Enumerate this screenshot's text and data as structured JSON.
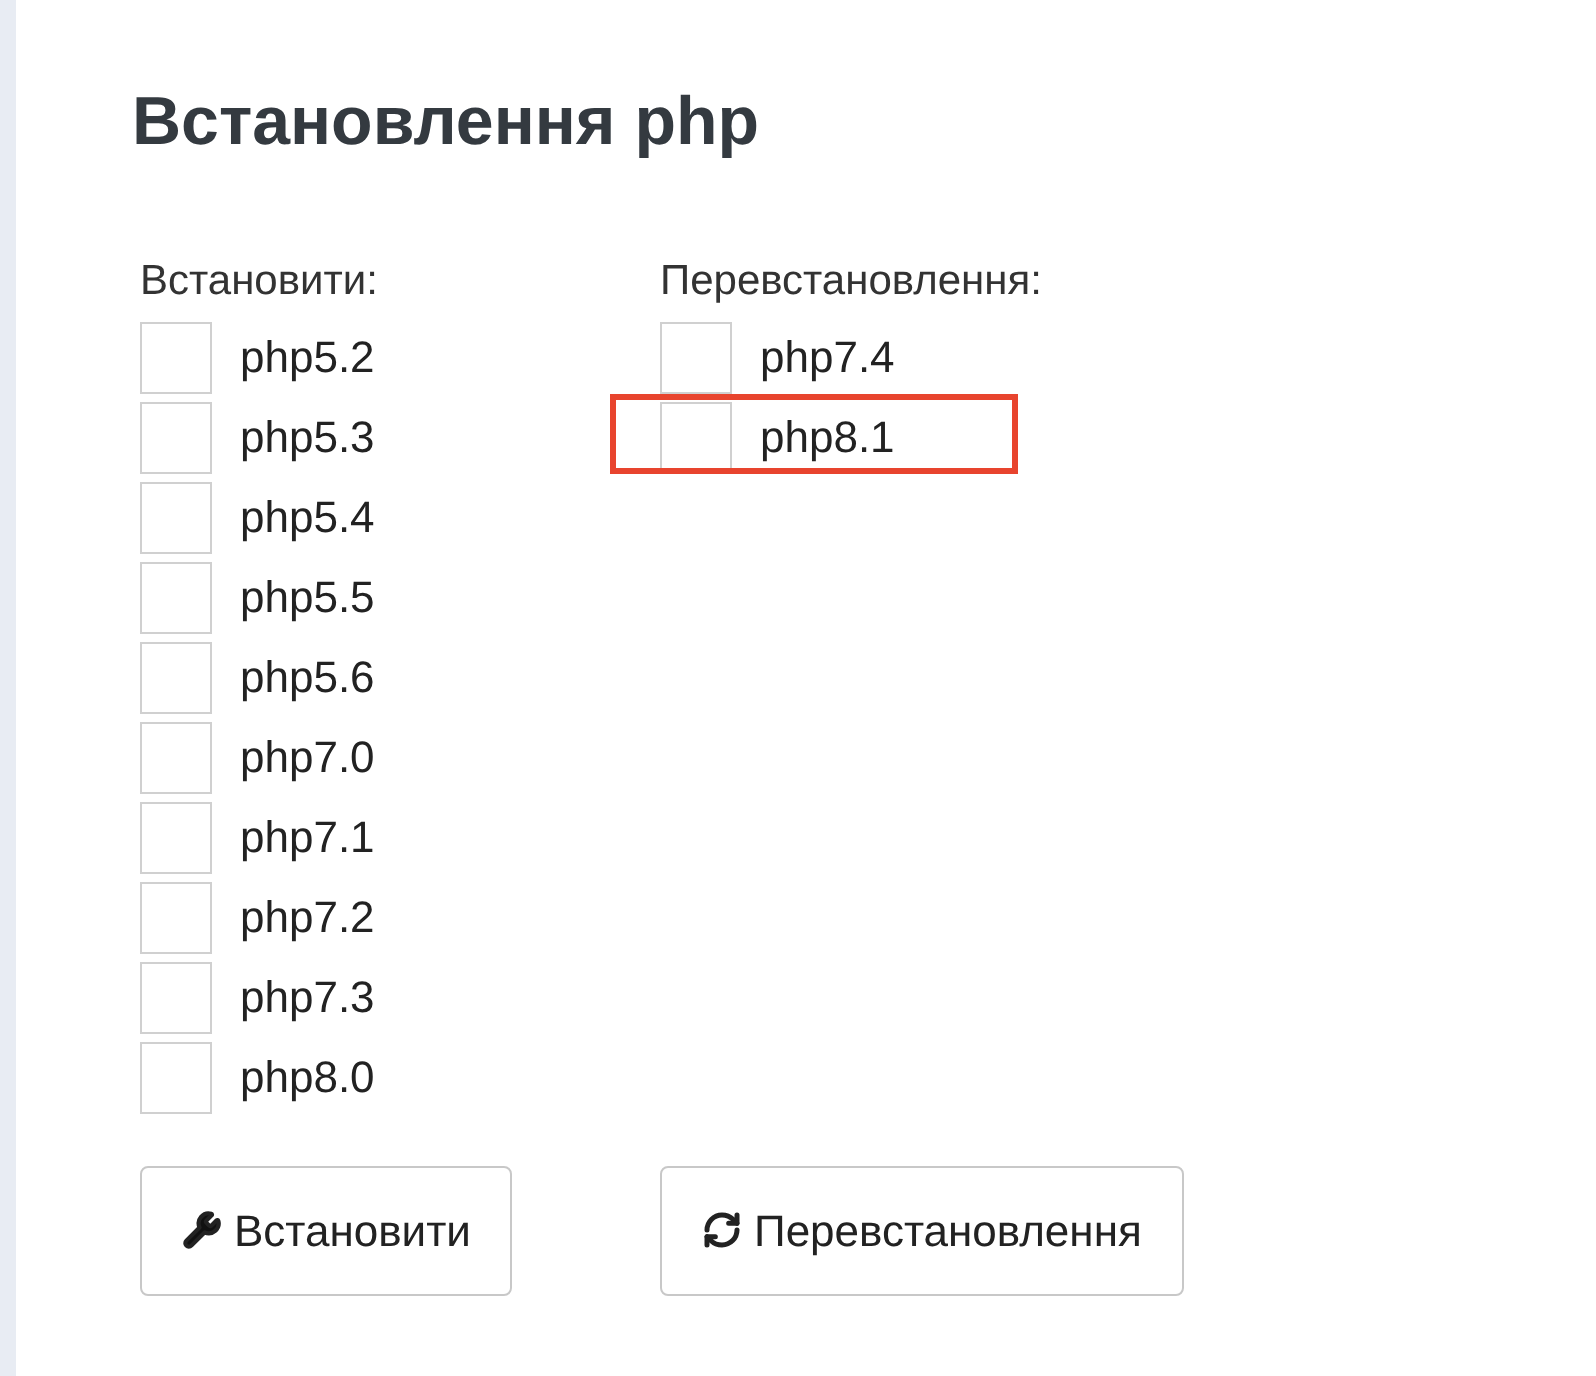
{
  "title": "Встановлення php",
  "install": {
    "label": "Встановити:",
    "items": [
      {
        "label": "php5.2",
        "checked": false
      },
      {
        "label": "php5.3",
        "checked": false
      },
      {
        "label": "php5.4",
        "checked": false
      },
      {
        "label": "php5.5",
        "checked": false
      },
      {
        "label": "php5.6",
        "checked": false
      },
      {
        "label": "php7.0",
        "checked": false
      },
      {
        "label": "php7.1",
        "checked": false
      },
      {
        "label": "php7.2",
        "checked": false
      },
      {
        "label": "php7.3",
        "checked": false
      },
      {
        "label": "php8.0",
        "checked": false
      }
    ]
  },
  "reinstall": {
    "label": "Перевстановлення:",
    "items": [
      {
        "label": "php7.4",
        "checked": false,
        "highlighted": false
      },
      {
        "label": "php8.1",
        "checked": false,
        "highlighted": true
      }
    ]
  },
  "buttons": [
    {
      "kind": "install",
      "label": "Встановити"
    },
    {
      "kind": "reinstall",
      "label": "Перевстановлення"
    }
  ]
}
